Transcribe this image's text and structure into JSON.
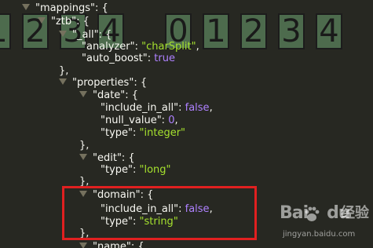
{
  "tiles": [
    "1",
    "2",
    "3",
    "4",
    "0",
    "1",
    "2",
    "3",
    "4"
  ],
  "json": {
    "mappings_key": "\"mappings\"",
    "ztb_key": "\"ztb\"",
    "all_key": "\"_all\"",
    "analyzer_key": "\"analyzer\"",
    "analyzer_val": "\"charSplit\"",
    "auto_boost_key": "\"auto_boost\"",
    "auto_boost_val": "true",
    "properties_key": "\"properties\"",
    "date_key": "\"date\"",
    "include_in_all_key": "\"include_in_all\"",
    "false_val": "false",
    "null_value_key": "\"null_value\"",
    "null_value_val": "0",
    "type_key": "\"type\"",
    "integer_val": "\"integer\"",
    "edit_key": "\"edit\"",
    "long_val": "\"long\"",
    "domain_key": "\"domain\"",
    "string_val": "\"string\"",
    "name_key": "\"name\""
  },
  "punct": {
    "open_obj": ": {",
    "colon": ": ",
    "comma": ",",
    "close_comma": "},"
  },
  "colors": {
    "background": "#272822",
    "string": "#a6e22e",
    "literal": "#ae81ff",
    "highlight": "#e02020",
    "tile": "#4d6b4d"
  },
  "watermark": {
    "logo": "Bai",
    "logo_tail": "du",
    "brand": "经验",
    "url": "jingyan.baidu.com"
  }
}
